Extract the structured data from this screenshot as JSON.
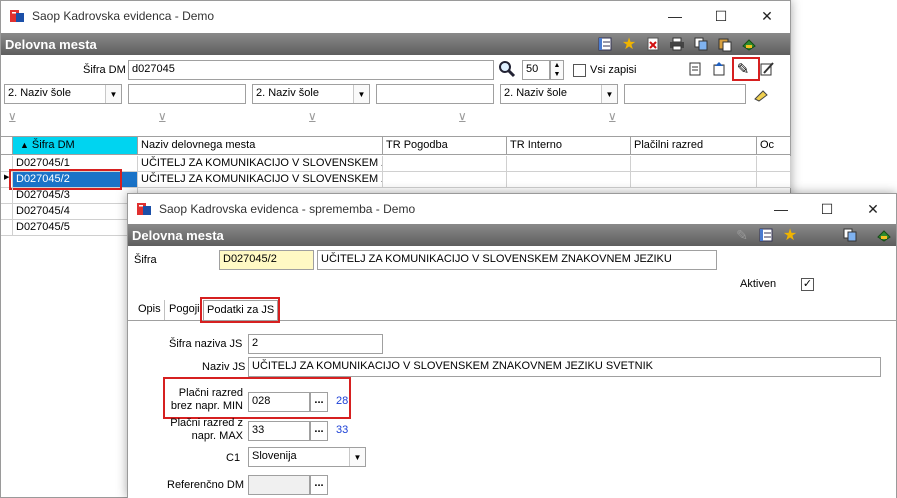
{
  "main": {
    "title": "Saop Kadrovska evidenca - Demo",
    "section": "Delovna mesta",
    "sifra_label": "Šifra DM",
    "sifra_value": "d027045",
    "count_value": "50",
    "vsi_label": "Vsi zapisi",
    "filters": [
      {
        "combo": "2. Naziv šole",
        "text": ""
      },
      {
        "combo": "2. Naziv šole",
        "text": ""
      },
      {
        "combo": "2. Naziv šole",
        "text": ""
      }
    ],
    "columns": [
      "Šifra DM",
      "Naziv delovnega mesta",
      "TR Pogodba",
      "TR Interno",
      "Plačilni razred",
      "Oc"
    ],
    "rows": [
      {
        "code": "D027045/1",
        "name": "UČITELJ ZA KOMUNIKACIJO V SLOVENSKEM ZNAKOVNEM JEZIKU"
      },
      {
        "code": "D027045/2",
        "name": "UČITELJ ZA KOMUNIKACIJO V SLOVENSKEM ZNAKOVNEM JEZIKU"
      },
      {
        "code": "D027045/3",
        "name": ""
      },
      {
        "code": "D027045/4",
        "name": ""
      },
      {
        "code": "D027045/5",
        "name": ""
      }
    ]
  },
  "dialog": {
    "title": "Saop Kadrovska evidenca - sprememba - Demo",
    "section": "Delovna mesta",
    "sifra_label": "Šifra",
    "sifra_value": "D027045/2",
    "naziv_value": "UČITELJ ZA KOMUNIKACIJO V SLOVENSKEM ZNAKOVNEM JEZIKU",
    "aktiven_label": "Aktiven",
    "aktiven_check": "✓",
    "tabs": [
      "Opis",
      "Pogoji",
      "Podatki za JS"
    ],
    "sifra_naziva_label": "Šifra naziva JS",
    "sifra_naziva_value": "2",
    "naziv_js_label": "Naziv JS",
    "naziv_js_value": "UČITELJ ZA KOMUNIKACIJO V SLOVENSKEM ZNAKOVNEM JEZIKU SVETNIK",
    "min_label_1": "Plačni razred",
    "min_label_2": "brez napr. MIN",
    "min_value": "028",
    "min_link": "28",
    "max_label_1": "Plačni razred z",
    "max_label_2": "napr. MAX",
    "max_value": "33",
    "max_link": "33",
    "c1_label": "C1",
    "c1_value": "Slovenija",
    "ref_label": "Referenčno DM",
    "ref_value": "",
    "ellipsis": "..."
  },
  "icons": {
    "minimize": "—",
    "maximize": "☐",
    "close": "✕",
    "search": "🔍",
    "dropdown": "▼",
    "sort_up": "▲",
    "filter": "⊻",
    "star": "★",
    "edit": "✎"
  },
  "colors": {
    "band": "#6e6e6e",
    "selected_row": "#1a73c8",
    "header_highlight": "#00d4f0",
    "yellow_field": "#fff9c4",
    "highlight_box": "#d62020",
    "link_blue": "#1a3fd6"
  }
}
